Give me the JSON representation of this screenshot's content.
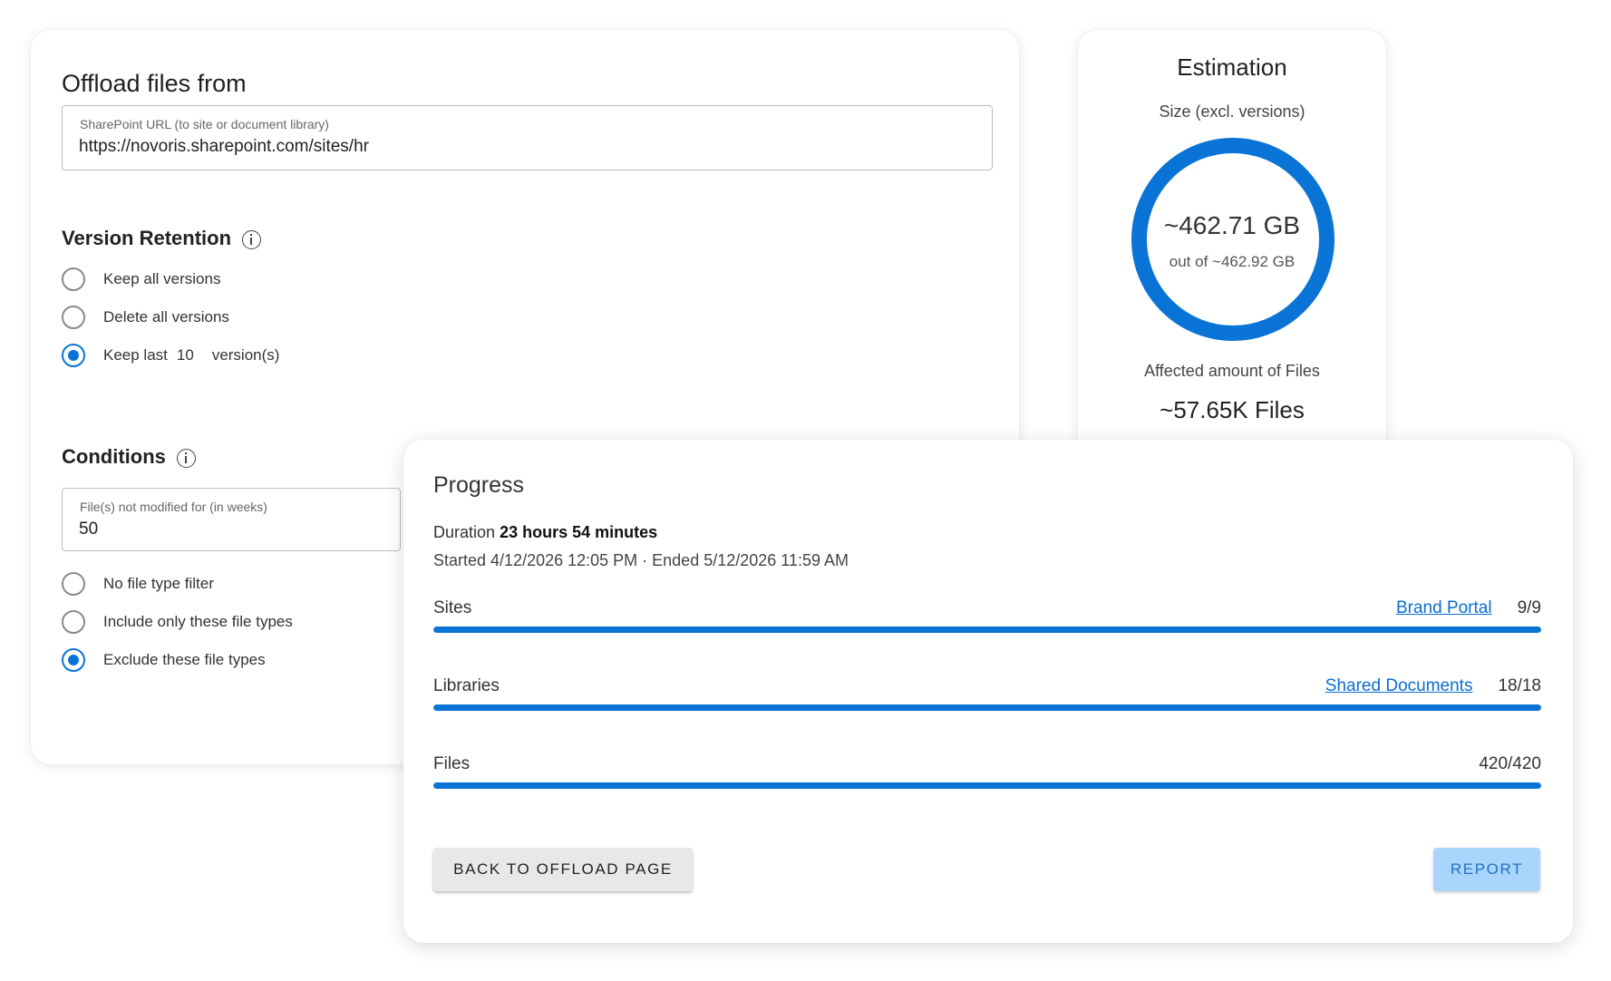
{
  "offload": {
    "title": "Offload files from",
    "url_field": {
      "label": "SharePoint URL (to site or document library)",
      "value": "https://novoris.sharepoint.com/sites/hr"
    },
    "version_retention": {
      "title": "Version Retention",
      "options": [
        {
          "label": "Keep all versions",
          "selected": false
        },
        {
          "label": "Delete all versions",
          "selected": false
        },
        {
          "label_prefix": "Keep last",
          "count": "10",
          "label_suffix": "version(s)",
          "selected": true
        }
      ]
    },
    "conditions": {
      "title": "Conditions",
      "weeks_field": {
        "label": "File(s) not modified for (in weeks)",
        "value": "50"
      },
      "file_type_options": [
        {
          "label": "No file type filter",
          "selected": false
        },
        {
          "label": "Include only these file types",
          "selected": false
        },
        {
          "label": "Exclude these file types",
          "selected": true
        }
      ]
    }
  },
  "estimation": {
    "title": "Estimation",
    "size_label": "Size (excl. versions)",
    "size_value": "~462.71 GB",
    "size_total": "out of ~462.92 GB",
    "affected_label": "Affected amount of Files",
    "affected_value": "~57.65K Files"
  },
  "progress": {
    "title": "Progress",
    "duration_label": "Duration",
    "duration_value": "23 hours 54 minutes",
    "dates": "Started 4/12/2026 12:05 PM · Ended 5/12/2026 11:59 AM",
    "rows": [
      {
        "label": "Sites",
        "link": "Brand Portal",
        "count": "9/9",
        "percent": 100
      },
      {
        "label": "Libraries",
        "link": "Shared Documents",
        "count": "18/18",
        "percent": 100
      },
      {
        "label": "Files",
        "link": "",
        "count": "420/420",
        "percent": 100
      }
    ],
    "back_button": "BACK TO OFFLOAD PAGE",
    "report_button": "REPORT"
  },
  "colors": {
    "accent": "#0a74d6",
    "link": "#0a6ed1",
    "report_bg": "#a9d4fb"
  }
}
